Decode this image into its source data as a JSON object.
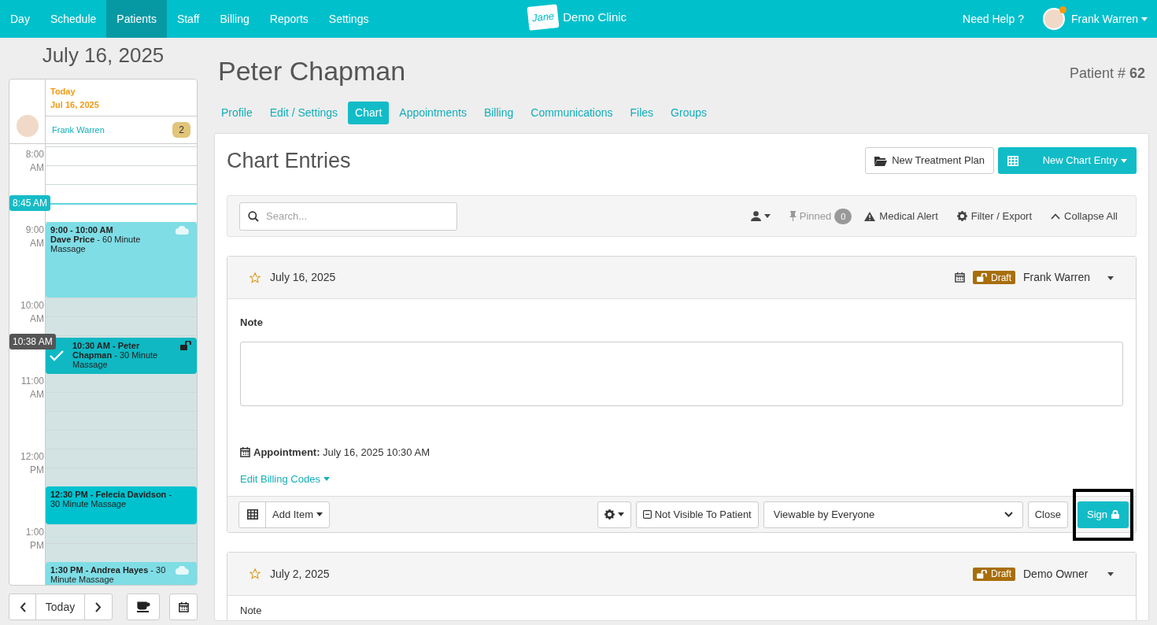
{
  "nav": {
    "items": [
      {
        "label": "Day",
        "selected": false
      },
      {
        "label": "Schedule",
        "selected": false
      },
      {
        "label": "Patients",
        "selected": true
      },
      {
        "label": "Staff",
        "selected": false
      },
      {
        "label": "Billing",
        "selected": false
      },
      {
        "label": "Reports",
        "selected": false
      },
      {
        "label": "Settings",
        "selected": false
      }
    ],
    "logo": "Jane",
    "clinic": "Demo Clinic",
    "help": "Need Help ?",
    "user": "Frank Warren",
    "notification": true
  },
  "sidebar": {
    "date": "July 16, 2025",
    "today": "Today",
    "day": "Jul 16, 2025",
    "staff": "Frank Warren",
    "count": "2",
    "hours": [
      {
        "hour": "8:00",
        "period": "AM"
      },
      {
        "hour": "9:00",
        "period": "AM"
      },
      {
        "hour": "10:00",
        "period": "AM"
      },
      {
        "hour": "11:00",
        "period": "AM"
      },
      {
        "hour": "12:00",
        "period": "PM"
      },
      {
        "hour": "1:00",
        "period": "PM"
      }
    ],
    "markers": [
      {
        "label": "8:45 AM",
        "kind": "now"
      },
      {
        "label": "10:38 AM",
        "kind": "current"
      }
    ],
    "appointments": [
      {
        "kind": "online",
        "title": "9:00 - 10:00 AM",
        "text": "**Dave Price** - 60 Minute Massage"
      },
      {
        "kind": "current",
        "text": "**10:30 AM - Peter Chapman** - 30 Minute Massage"
      },
      {
        "kind": "booked",
        "text": "**12:30 PM - Felecia Davidson** - 30 Minute Massage"
      },
      {
        "kind": "online",
        "text": "**1:30 PM - Andrea Hayes** - 30 Minute Massage"
      }
    ],
    "today_button": "Today"
  },
  "patient": {
    "name": "Peter Chapman",
    "number": "Patient # **62**",
    "tabs": [
      {
        "label": "Profile",
        "selected": false
      },
      {
        "label": "Edit / Settings",
        "selected": false
      },
      {
        "label": "Chart",
        "selected": true
      },
      {
        "label": "Appointments",
        "selected": false
      },
      {
        "label": "Billing",
        "selected": false
      },
      {
        "label": "Communications",
        "selected": false
      },
      {
        "label": "Files",
        "selected": false
      },
      {
        "label": "Groups",
        "selected": false
      }
    ]
  },
  "chart": {
    "title": "Chart Entries",
    "new_plan": "New Treatment Plan",
    "new_entry": "New Chart Entry",
    "toolbar": {
      "placeholder": "Search...",
      "pinned": "Pinned",
      "pinned_count": "0",
      "medical_alert": "Medical Alert",
      "filter": "Filter / Export",
      "collapse": "Collapse All"
    },
    "entries": [
      {
        "date": "July 16, 2025",
        "starred": false,
        "status": "Draft",
        "author": "Frank Warren",
        "expanded": true,
        "note_label": "Note",
        "appointment_label": "Appointment:",
        "appointment": "July 16, 2025 10:30 AM",
        "billing": "Edit Billing Codes",
        "add_item": "Add Item",
        "visibility": "Not Visible To Patient",
        "viewable": "Viewable by Everyone",
        "close": "Close",
        "sign": "Sign",
        "sign_highlighted": true
      },
      {
        "date": "July 2, 2025",
        "starred": false,
        "status": "Draft",
        "author": "Demo Owner",
        "expanded": false,
        "note_label": "Note"
      }
    ]
  }
}
